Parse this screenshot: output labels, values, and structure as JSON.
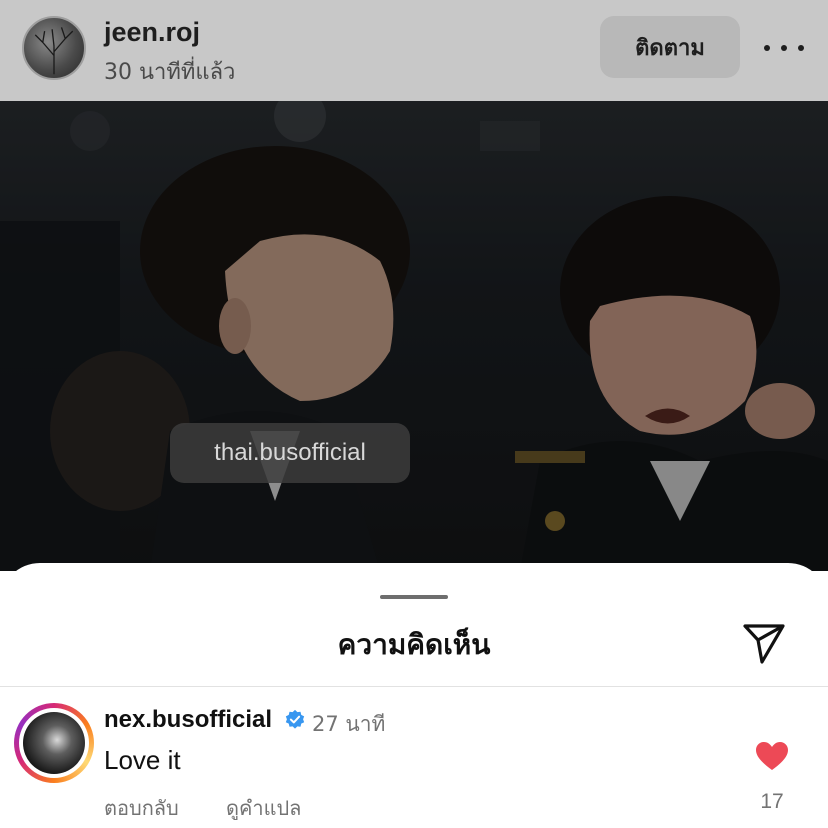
{
  "post": {
    "username": "jeen.roj",
    "time_ago": "30 นาทีที่แล้ว",
    "follow_label": "ติดตาม",
    "tagged_user": "thai.busofficial"
  },
  "comments_sheet": {
    "title": "ความคิดเห็น",
    "comment": {
      "username": "nex.busofficial",
      "time": "27 นาที",
      "text": "Love it",
      "reply_label": "ตอบกลับ",
      "translate_label": "ดูคำแปล",
      "like_count": "17"
    }
  },
  "colors": {
    "verified": "#3897f0",
    "like": "#ed4956",
    "muted_text": "#737373"
  },
  "icons": [
    "more-icon",
    "send-icon",
    "verified-badge-icon",
    "heart-icon"
  ]
}
